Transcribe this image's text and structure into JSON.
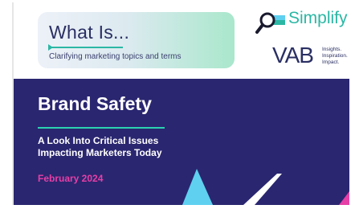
{
  "badge": {
    "title": "What Is...",
    "subtitle": "Clarifying marketing topics and terms"
  },
  "logos": {
    "simplify": "Simplify",
    "vab": "VAB",
    "vab_tagline": [
      "Insights.",
      "Inspiration.",
      "Impact."
    ]
  },
  "hero": {
    "title": "Brand Safety",
    "subtitle_lines": [
      "A Look Into Critical Issues",
      "Impacting Marketers Today"
    ],
    "date": "February 2024"
  },
  "colors": {
    "navy": "#2a2670",
    "teal": "#2bb7a4",
    "pink": "#e63fa6",
    "cyan": "#5fd0f0"
  },
  "icons": [
    "magnifier-icon",
    "vab-logo"
  ]
}
